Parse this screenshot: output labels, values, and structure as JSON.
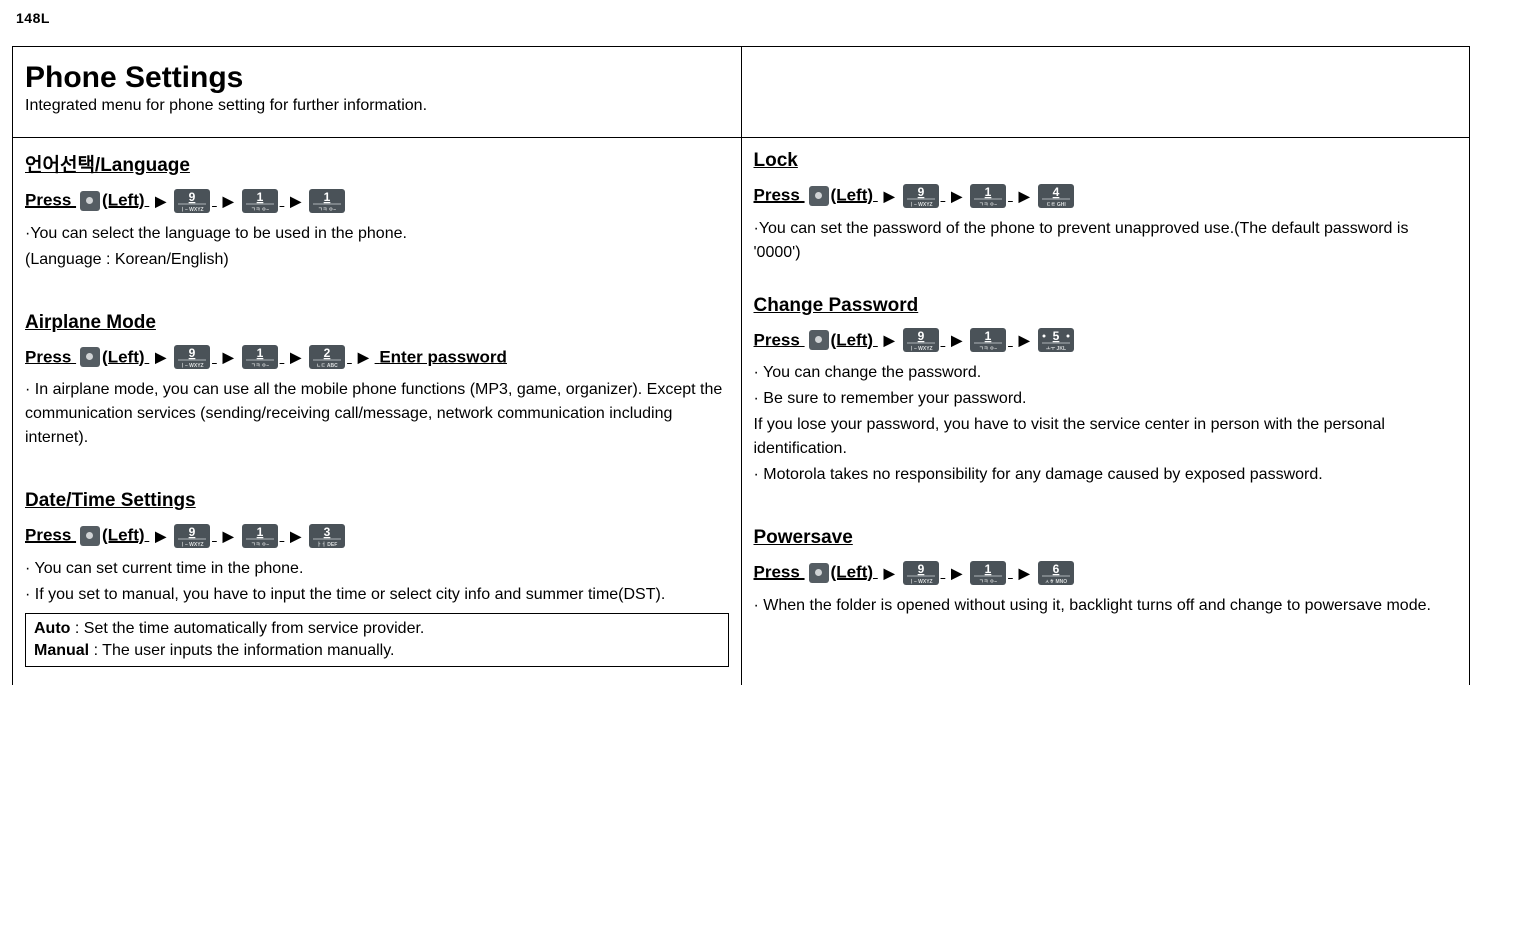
{
  "page_number": "148L",
  "header": {
    "title": "Phone Settings",
    "subtitle": "Integrated menu for phone setting for further information."
  },
  "press_word": "Press",
  "left_word": "(Left)",
  "arrow": "▶",
  "enter_password_suffix": "Enter password",
  "left_col": {
    "language": {
      "heading": "언어선택/Language",
      "keys": [
        "9",
        "1",
        "1"
      ],
      "lines": [
        "·You can select the language to be used in the phone.",
        "(Language : Korean/English)"
      ]
    },
    "airplane": {
      "heading": "Airplane Mode",
      "keys": [
        "9",
        "1",
        "2"
      ],
      "has_enter_pw": true,
      "lines": [
        "· In airplane mode, you can use all the mobile phone functions (MP3, game, organizer). Except the communication services (sending/receiving call/message, network communication including internet)."
      ]
    },
    "datetime": {
      "heading": "Date/Time Settings",
      "keys": [
        "9",
        "1",
        "3"
      ],
      "lines": [
        "· You can set current time in the phone.",
        "· If you set to manual, you have to input the time or select city info and summer time(DST)."
      ],
      "box": {
        "auto_label": "Auto",
        "auto_text": " : Set the time automatically from service provider.",
        "manual_label": "Manual",
        "manual_text": " : The user inputs the information manually."
      }
    }
  },
  "right_col": {
    "lock": {
      "heading": "Lock",
      "keys": [
        "9",
        "1",
        "4"
      ],
      "lines": [
        "·You can set the password of the phone to prevent unapproved use.(The default password is '0000')"
      ]
    },
    "changepw": {
      "heading": "Change Password",
      "keys": [
        "9",
        "1",
        "5"
      ],
      "lines": [
        "· You can change the password.",
        "· Be sure to remember your password.",
        "If you lose your password, you have to visit the service center in person with the personal identification.",
        "· Motorola takes no responsibility for any damage caused by exposed password."
      ]
    },
    "powersave": {
      "heading": "Powersave",
      "keys": [
        "9",
        "1",
        "6"
      ],
      "lines": [
        "· When the folder is opened without using it, backlight turns off and change to powersave mode."
      ]
    }
  },
  "keypad_labels": {
    "1": {
      "big": "1",
      "small": "ㄱㅋ ㅇ–"
    },
    "2": {
      "big": "2",
      "small": "ㄴㄷ ABC"
    },
    "3": {
      "big": "3",
      "small": "ㅏㅓ DEF"
    },
    "4": {
      "big": "4",
      "small": "ㄷㅌ GHI"
    },
    "5": {
      "big": "5",
      "small": "ㅗㅜ JKL",
      "dots": true
    },
    "6": {
      "big": "6",
      "small": "ㅅㅎ MNO"
    },
    "9": {
      "big": "9",
      "small": "ㅣ– WXYZ"
    }
  }
}
